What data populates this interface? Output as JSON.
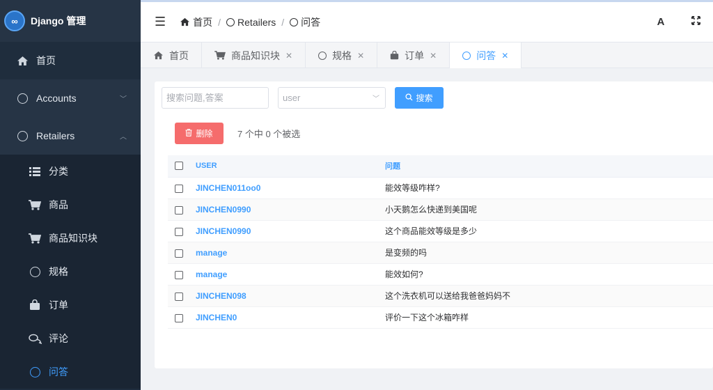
{
  "brand": {
    "title": "Django 管理",
    "logo": "∞"
  },
  "sidebar": {
    "home": "首页",
    "accounts": "Accounts",
    "retailers": "Retailers",
    "sub": [
      {
        "label": "分类",
        "icon": "list-icon"
      },
      {
        "label": "商品",
        "icon": "cart-icon"
      },
      {
        "label": "商品知识块",
        "icon": "cart-icon"
      },
      {
        "label": "规格",
        "icon": "circle-icon"
      },
      {
        "label": "订单",
        "icon": "bag-icon"
      },
      {
        "label": "评论",
        "icon": "comments-icon"
      },
      {
        "label": "问答",
        "icon": "circle-icon"
      }
    ]
  },
  "breadcrumb": {
    "home": "首页",
    "section": "Retailers",
    "page": "问答"
  },
  "topright": {
    "font_btn": "A"
  },
  "tabs": [
    {
      "label": "首页"
    },
    {
      "label": "商品知识块"
    },
    {
      "label": "规格"
    },
    {
      "label": "订单"
    },
    {
      "label": "问答"
    }
  ],
  "search": {
    "placeholder": "搜索问题,答案",
    "select_placeholder": "user",
    "button": "搜索"
  },
  "actions": {
    "delete": "删除",
    "selected": "7 个中 0 个被选"
  },
  "table": {
    "headers": {
      "user": "USER",
      "question": "问题"
    },
    "rows": [
      {
        "user": "JINCHEN011oo0",
        "question": "能效等级咋样?"
      },
      {
        "user": "JINCHEN0990",
        "question": "小天鹅怎么快递到美国呢"
      },
      {
        "user": "JINCHEN0990",
        "question": "这个商品能效等级是多少"
      },
      {
        "user": "manage",
        "question": "是变频的吗"
      },
      {
        "user": "manage",
        "question": "能效如何?"
      },
      {
        "user": "JINCHEN098",
        "question": "这个洗衣机可以送给我爸爸妈妈不"
      },
      {
        "user": "JINCHEN0",
        "question": "评价一下这个冰箱咋样"
      }
    ]
  },
  "colors": {
    "accent": "#409eff",
    "danger": "#f56c6c",
    "sidebar": "#1f2d3d"
  }
}
